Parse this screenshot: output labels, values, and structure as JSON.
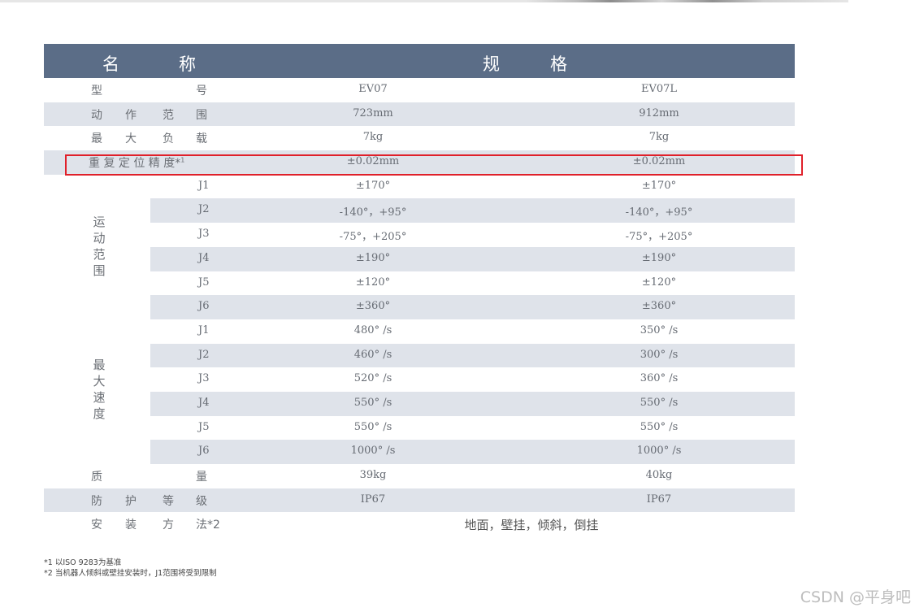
{
  "header": {
    "name_chars": [
      "名",
      "称"
    ],
    "spec_chars": [
      "规",
      "格"
    ]
  },
  "rows": {
    "model": {
      "chars": [
        "型",
        "号"
      ],
      "v1": "EV07",
      "v2": "EV07L"
    },
    "range": {
      "chars": [
        "动",
        "作",
        "范",
        "围"
      ],
      "v1": "723mm",
      "v2": "912mm"
    },
    "payload": {
      "chars": [
        "最",
        "大",
        "负",
        "载"
      ],
      "v1": "7kg",
      "v2": "7kg"
    },
    "repeat": {
      "label": "重 复 定  位 精  度*",
      "sup": "1",
      "v1": "±0.02mm",
      "v2": "±0.02mm"
    },
    "mass": {
      "chars": [
        "质",
        "量"
      ],
      "v1": "39kg",
      "v2": "40kg"
    },
    "ip": {
      "chars": [
        "防",
        "护",
        "等",
        "级"
      ],
      "v1": "IP67",
      "v2": "IP67"
    },
    "install": {
      "chars": [
        "安",
        "装",
        "方",
        "法*2"
      ],
      "value": "地面，壁挂，倾斜，倒挂"
    }
  },
  "motion": {
    "label": [
      "运",
      "动",
      "范",
      "围"
    ],
    "joints": [
      {
        "j": "J1",
        "v1": "±170°",
        "v2": "±170°"
      },
      {
        "j": "J2",
        "v1": "-140°，+95°",
        "v2": "-140°，+95°"
      },
      {
        "j": "J3",
        "v1": "-75°，+205°",
        "v2": "-75°，+205°"
      },
      {
        "j": "J4",
        "v1": "±190°",
        "v2": "±190°"
      },
      {
        "j": "J5",
        "v1": "±120°",
        "v2": "±120°"
      },
      {
        "j": "J6",
        "v1": "±360°",
        "v2": "±360°"
      }
    ]
  },
  "speed": {
    "label": [
      "最",
      "大",
      "速",
      "度"
    ],
    "joints": [
      {
        "j": "J1",
        "v1": "480° /s",
        "v2": "350° /s"
      },
      {
        "j": "J2",
        "v1": "460° /s",
        "v2": "300° /s"
      },
      {
        "j": "J3",
        "v1": "520° /s",
        "v2": "360° /s"
      },
      {
        "j": "J4",
        "v1": "550° /s",
        "v2": "550° /s"
      },
      {
        "j": "J5",
        "v1": "550° /s",
        "v2": "550° /s"
      },
      {
        "j": "J6",
        "v1": "1000° /s",
        "v2": "1000° /s"
      }
    ]
  },
  "notes": [
    "*1 以ISO 9283为基准",
    "*2 当机器人倾斜或壁挂安装时，J1范围将受到限制"
  ],
  "watermark": "CSDN @平身吧",
  "colors": {
    "header": "#5b6d87",
    "stripe": "#dfe3ea",
    "highlight": "#e0202a"
  }
}
